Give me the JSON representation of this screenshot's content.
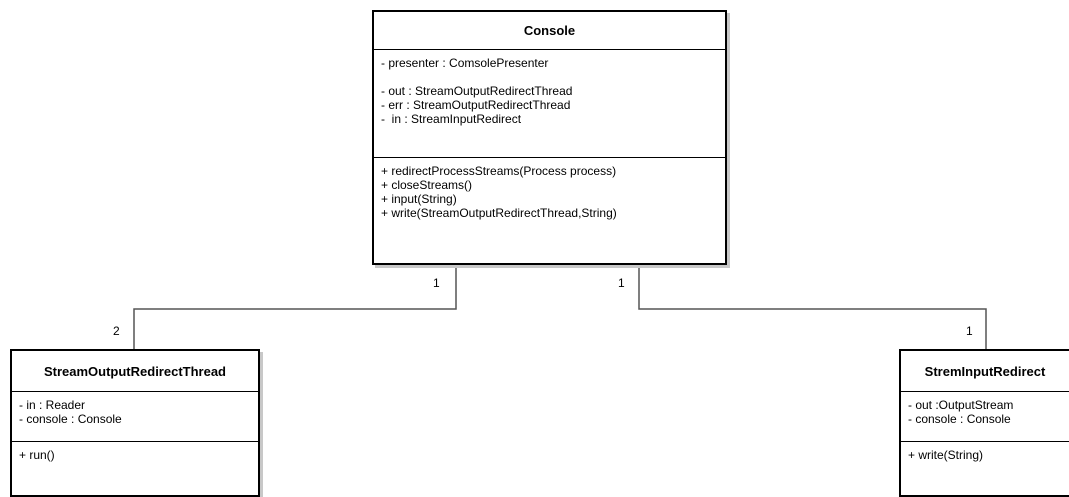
{
  "classes": {
    "console": {
      "name": "Console",
      "attributes_group1": [
        "- presenter : ComsolePresenter"
      ],
      "attributes_group2": [
        "- out : StreamOutputRedirectThread",
        "- err : StreamOutputRedirectThread",
        "-  in : StreamInputRedirect"
      ],
      "operations": [
        "+ redirectProcessStreams(Process process)",
        "+ closeStreams()",
        "+ input(String)",
        "+ write(StreamOutputRedirectThread,String)"
      ]
    },
    "stream_output": {
      "name": "StreamOutputRedirectThread",
      "attributes": [
        "- in : Reader",
        "- console : Console"
      ],
      "operations": [
        "+ run()"
      ]
    },
    "stream_input": {
      "name": "StremInputRedirect",
      "attributes": [
        "- out :OutputStream",
        "- console : Console"
      ],
      "operations": [
        "+ write(String)"
      ]
    }
  },
  "associations": [
    {
      "from": "Console",
      "to": "StreamOutputRedirectThread",
      "source_multiplicity": "1",
      "target_multiplicity": "2"
    },
    {
      "from": "Console",
      "to": "StremInputRedirect",
      "source_multiplicity": "1",
      "target_multiplicity": "1"
    }
  ],
  "colors": {
    "border": "#000000",
    "shadow": "#c8c8c8",
    "background": "#ffffff"
  }
}
